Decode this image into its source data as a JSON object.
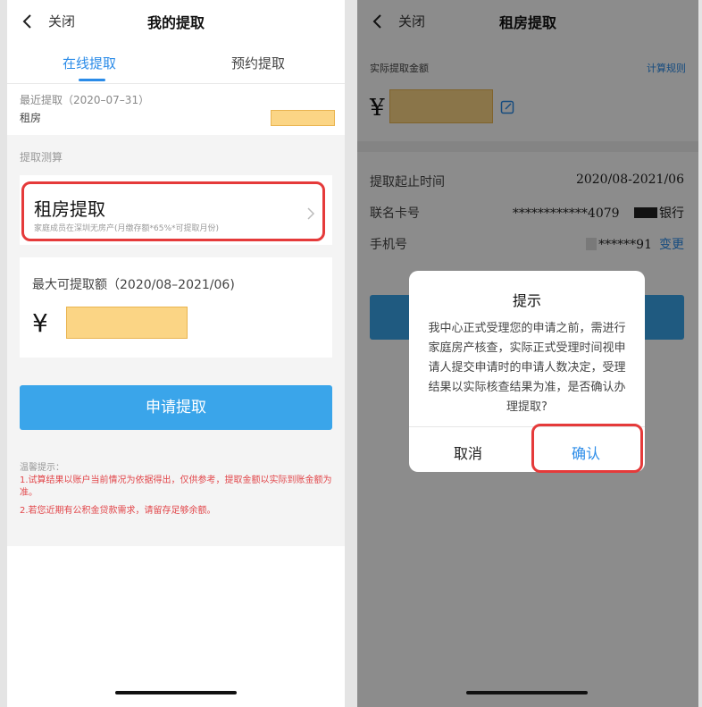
{
  "left": {
    "header": {
      "close_label": "关闭",
      "title": "我的提取"
    },
    "tabs": [
      {
        "label": "在线提取"
      },
      {
        "label": "预约提取"
      }
    ],
    "recent": {
      "label": "最近提取（2020–07–31）",
      "type": "租房"
    },
    "section_label": "提取测算",
    "rent_card": {
      "title": "租房提取",
      "subtitle": "家庭成员在深圳无房产(月缴存额*65%*可提取月份)"
    },
    "max_card": {
      "label": "最大可提取额（2020/08–2021/06)",
      "currency": "¥"
    },
    "apply_button": "申请提取",
    "tips": {
      "title": "温馨提示：",
      "items": [
        "1.试算结果以账户当前情况为依据得出，仅供参考，提取金额以实际到账金额为准。",
        "2.若您近期有公积金贷款需求，请留存足够余额。"
      ]
    }
  },
  "right": {
    "header": {
      "close_label": "关闭",
      "title": "租房提取"
    },
    "amount_label": "实际提取金额",
    "rule_link": "计算规则",
    "currency": "¥",
    "rows": {
      "period": {
        "label": "提取起止时间",
        "value": "2020/08-2021/06"
      },
      "card": {
        "label": "联名卡号",
        "value": "************4079",
        "bank": "银行"
      },
      "phone": {
        "label": "手机号",
        "value": "******91",
        "action": "变更"
      }
    },
    "dialog": {
      "title": "提示",
      "message": "我中心正式受理您的申请之前，需进行家庭房产核查，实际正式受理时间视申请人提交申请时的申请人数决定，受理结果以实际核查结果为准，是否确认办理提取?",
      "cancel": "取消",
      "confirm": "确认"
    }
  },
  "colors": {
    "accent": "#2a8be8",
    "button": "#3aa5ea",
    "warning": "#e2464a",
    "highlight_box": "#e53a3a",
    "mask": "#fbd585"
  }
}
